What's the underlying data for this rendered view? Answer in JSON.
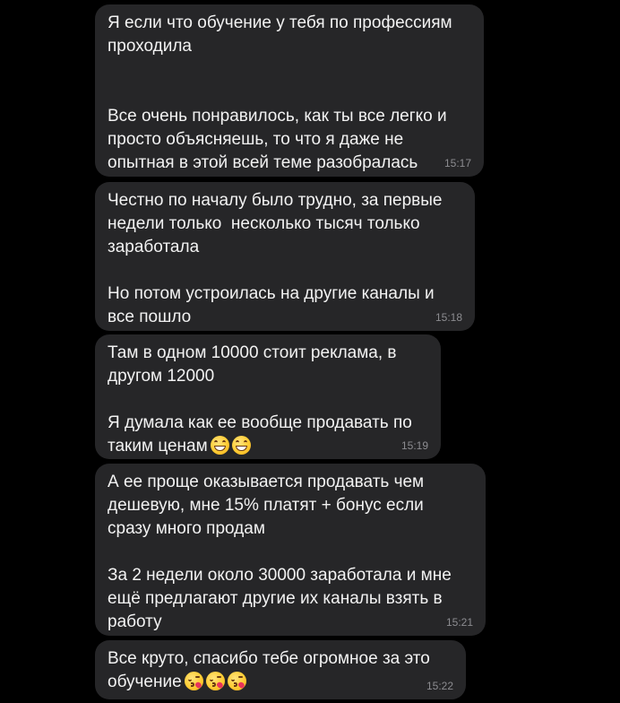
{
  "messages": [
    {
      "lines": [
        "Я если что обучение у тебя по профессиям",
        "проходила",
        "",
        "",
        "Все очень понравилось, как ты все легко и",
        "просто объясняешь, то что я даже не",
        "опытная в этой всей теме разобралась"
      ],
      "time": "15:17"
    },
    {
      "lines": [
        "Честно по началу было трудно, за первые",
        "недели только  несколько тысяч только",
        "заработала",
        "",
        "Но потом устроилась на другие каналы и",
        "все пошло"
      ],
      "time": "15:18"
    },
    {
      "lines": [
        "Там в одном 10000 стоит реклама, в",
        "другом 12000",
        "",
        "Я думала как ее вообще продавать по",
        "таким ценам"
      ],
      "emojis": [
        "grinning-face-with-smiling-eyes",
        "grinning-face-with-smiling-eyes"
      ],
      "time": "15:19"
    },
    {
      "lines": [
        "А ее проще оказывается продавать чем",
        "дешевую, мне 15% платят + бонус если",
        "сразу много продам",
        "",
        "За 2 недели около 30000 заработала и мне",
        "ещё предлагают другие их каналы взять в",
        "работу"
      ],
      "time": "15:21"
    },
    {
      "lines": [
        "Все круто, спасибо тебе огромное за это",
        "обучение"
      ],
      "emojis": [
        "face-blowing-a-kiss",
        "face-blowing-a-kiss",
        "face-blowing-a-kiss"
      ],
      "time": "15:22"
    }
  ],
  "colors": {
    "background": "#000000",
    "bubble": "#262628",
    "text": "#f2f2f2",
    "timestamp": "#8c8c90"
  }
}
